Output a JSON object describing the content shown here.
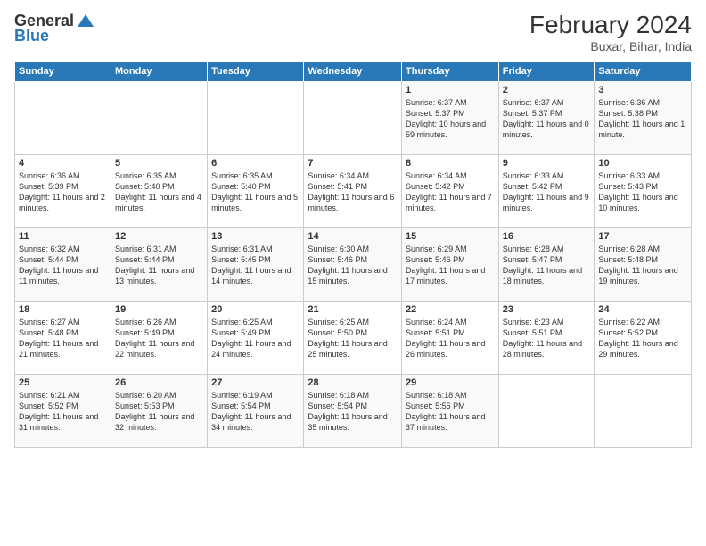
{
  "logo": {
    "general": "General",
    "blue": "Blue"
  },
  "title": {
    "month_year": "February 2024",
    "location": "Buxar, Bihar, India"
  },
  "days_of_week": [
    "Sunday",
    "Monday",
    "Tuesday",
    "Wednesday",
    "Thursday",
    "Friday",
    "Saturday"
  ],
  "weeks": [
    [
      {
        "day": "",
        "info": ""
      },
      {
        "day": "",
        "info": ""
      },
      {
        "day": "",
        "info": ""
      },
      {
        "day": "",
        "info": ""
      },
      {
        "day": "1",
        "info": "Sunrise: 6:37 AM\nSunset: 5:37 PM\nDaylight: 10 hours and 59 minutes."
      },
      {
        "day": "2",
        "info": "Sunrise: 6:37 AM\nSunset: 5:37 PM\nDaylight: 11 hours and 0 minutes."
      },
      {
        "day": "3",
        "info": "Sunrise: 6:36 AM\nSunset: 5:38 PM\nDaylight: 11 hours and 1 minute."
      }
    ],
    [
      {
        "day": "4",
        "info": "Sunrise: 6:36 AM\nSunset: 5:39 PM\nDaylight: 11 hours and 2 minutes."
      },
      {
        "day": "5",
        "info": "Sunrise: 6:35 AM\nSunset: 5:40 PM\nDaylight: 11 hours and 4 minutes."
      },
      {
        "day": "6",
        "info": "Sunrise: 6:35 AM\nSunset: 5:40 PM\nDaylight: 11 hours and 5 minutes."
      },
      {
        "day": "7",
        "info": "Sunrise: 6:34 AM\nSunset: 5:41 PM\nDaylight: 11 hours and 6 minutes."
      },
      {
        "day": "8",
        "info": "Sunrise: 6:34 AM\nSunset: 5:42 PM\nDaylight: 11 hours and 7 minutes."
      },
      {
        "day": "9",
        "info": "Sunrise: 6:33 AM\nSunset: 5:42 PM\nDaylight: 11 hours and 9 minutes."
      },
      {
        "day": "10",
        "info": "Sunrise: 6:33 AM\nSunset: 5:43 PM\nDaylight: 11 hours and 10 minutes."
      }
    ],
    [
      {
        "day": "11",
        "info": "Sunrise: 6:32 AM\nSunset: 5:44 PM\nDaylight: 11 hours and 11 minutes."
      },
      {
        "day": "12",
        "info": "Sunrise: 6:31 AM\nSunset: 5:44 PM\nDaylight: 11 hours and 13 minutes."
      },
      {
        "day": "13",
        "info": "Sunrise: 6:31 AM\nSunset: 5:45 PM\nDaylight: 11 hours and 14 minutes."
      },
      {
        "day": "14",
        "info": "Sunrise: 6:30 AM\nSunset: 5:46 PM\nDaylight: 11 hours and 15 minutes."
      },
      {
        "day": "15",
        "info": "Sunrise: 6:29 AM\nSunset: 5:46 PM\nDaylight: 11 hours and 17 minutes."
      },
      {
        "day": "16",
        "info": "Sunrise: 6:28 AM\nSunset: 5:47 PM\nDaylight: 11 hours and 18 minutes."
      },
      {
        "day": "17",
        "info": "Sunrise: 6:28 AM\nSunset: 5:48 PM\nDaylight: 11 hours and 19 minutes."
      }
    ],
    [
      {
        "day": "18",
        "info": "Sunrise: 6:27 AM\nSunset: 5:48 PM\nDaylight: 11 hours and 21 minutes."
      },
      {
        "day": "19",
        "info": "Sunrise: 6:26 AM\nSunset: 5:49 PM\nDaylight: 11 hours and 22 minutes."
      },
      {
        "day": "20",
        "info": "Sunrise: 6:25 AM\nSunset: 5:49 PM\nDaylight: 11 hours and 24 minutes."
      },
      {
        "day": "21",
        "info": "Sunrise: 6:25 AM\nSunset: 5:50 PM\nDaylight: 11 hours and 25 minutes."
      },
      {
        "day": "22",
        "info": "Sunrise: 6:24 AM\nSunset: 5:51 PM\nDaylight: 11 hours and 26 minutes."
      },
      {
        "day": "23",
        "info": "Sunrise: 6:23 AM\nSunset: 5:51 PM\nDaylight: 11 hours and 28 minutes."
      },
      {
        "day": "24",
        "info": "Sunrise: 6:22 AM\nSunset: 5:52 PM\nDaylight: 11 hours and 29 minutes."
      }
    ],
    [
      {
        "day": "25",
        "info": "Sunrise: 6:21 AM\nSunset: 5:52 PM\nDaylight: 11 hours and 31 minutes."
      },
      {
        "day": "26",
        "info": "Sunrise: 6:20 AM\nSunset: 5:53 PM\nDaylight: 11 hours and 32 minutes."
      },
      {
        "day": "27",
        "info": "Sunrise: 6:19 AM\nSunset: 5:54 PM\nDaylight: 11 hours and 34 minutes."
      },
      {
        "day": "28",
        "info": "Sunrise: 6:18 AM\nSunset: 5:54 PM\nDaylight: 11 hours and 35 minutes."
      },
      {
        "day": "29",
        "info": "Sunrise: 6:18 AM\nSunset: 5:55 PM\nDaylight: 11 hours and 37 minutes."
      },
      {
        "day": "",
        "info": ""
      },
      {
        "day": "",
        "info": ""
      }
    ]
  ]
}
